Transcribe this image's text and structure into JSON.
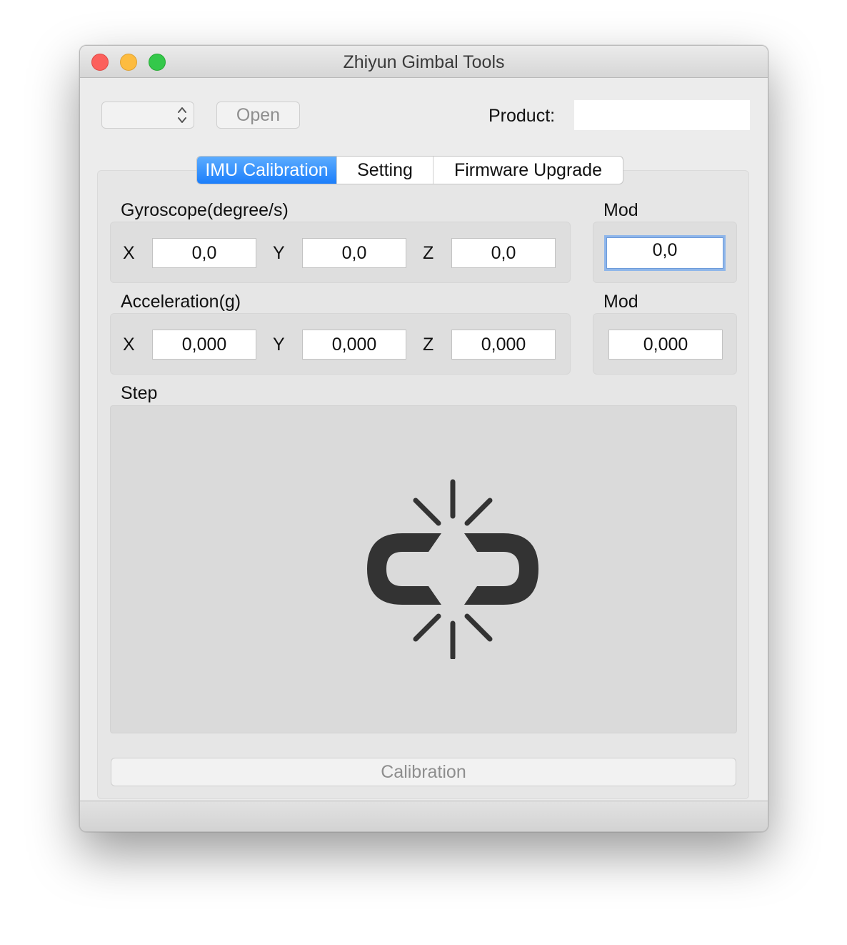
{
  "window": {
    "title": "Zhiyun Gimbal Tools"
  },
  "toolbar": {
    "port_select_value": "",
    "open_label": "Open",
    "product_label": "Product:",
    "product_value": ""
  },
  "tabs": [
    {
      "label": "IMU Calibration",
      "active": true
    },
    {
      "label": "Setting",
      "active": false
    },
    {
      "label": "Firmware Upgrade",
      "active": false
    }
  ],
  "gyroscope": {
    "label": "Gyroscope(degree/s)",
    "x_label": "X",
    "y_label": "Y",
    "z_label": "Z",
    "x": "0,0",
    "y": "0,0",
    "z": "0,0",
    "mod_label": "Mod",
    "mod": "0,0"
  },
  "acceleration": {
    "label": "Acceleration(g)",
    "x_label": "X",
    "y_label": "Y",
    "z_label": "Z",
    "x": "0,000",
    "y": "0,000",
    "z": "0,000",
    "mod_label": "Mod",
    "mod": "0,000"
  },
  "step": {
    "label": "Step",
    "icon": "broken-link-icon"
  },
  "actions": {
    "calibration_label": "Calibration"
  },
  "colors": {
    "active_tab": "#1b7efb",
    "window_bg": "#ececec",
    "icon": "#333333"
  }
}
